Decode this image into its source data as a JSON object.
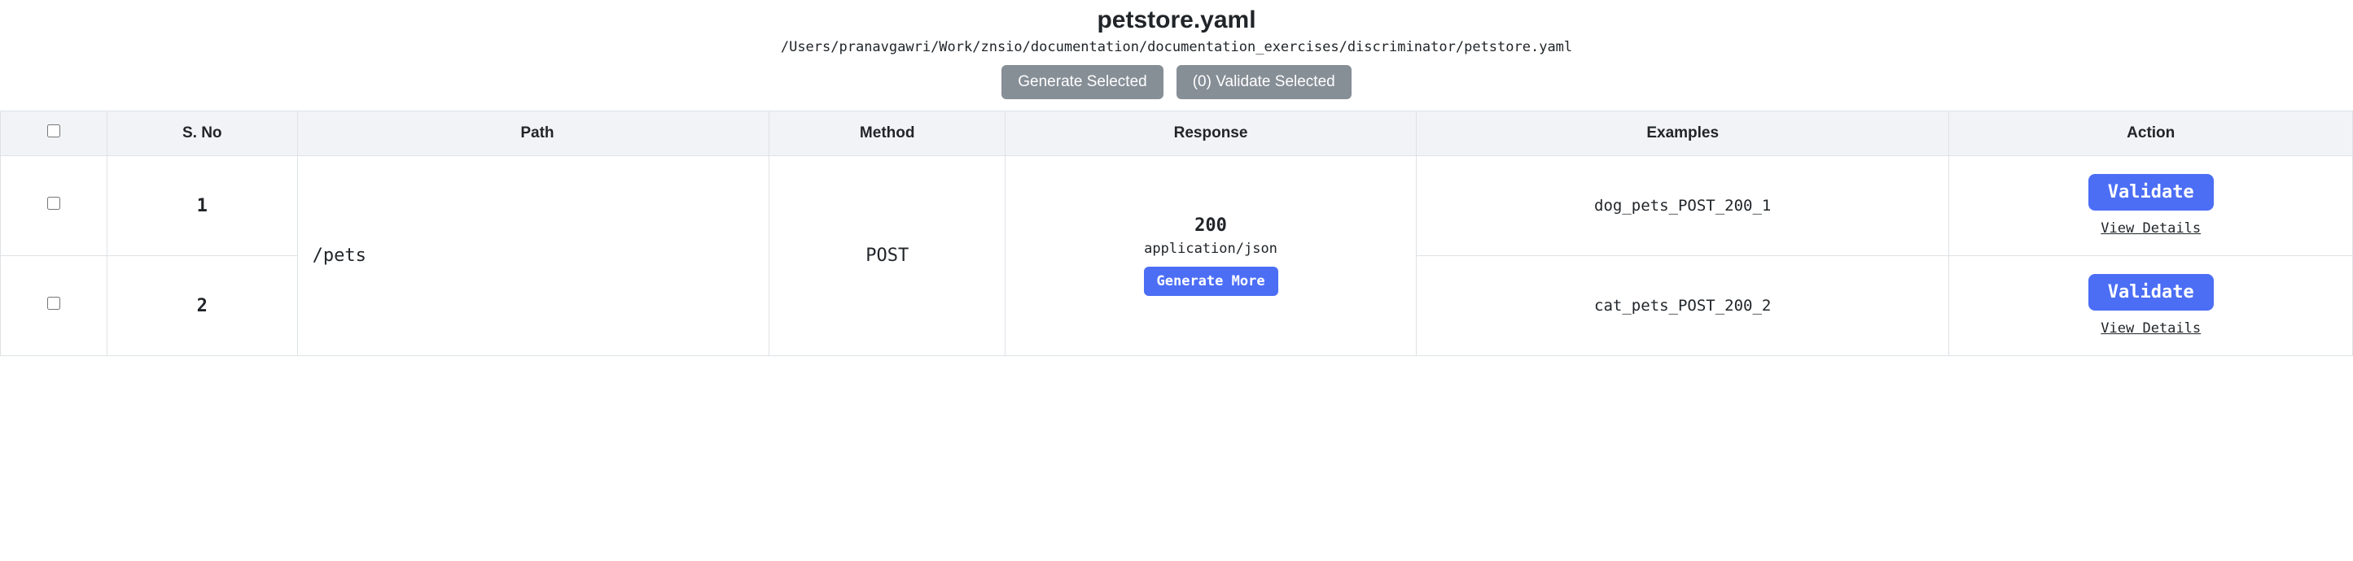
{
  "header": {
    "title": "petstore.yaml",
    "filepath": "/Users/pranavgawri/Work/znsio/documentation/documentation_exercises/discriminator/petstore.yaml"
  },
  "toolbar": {
    "generate_selected_label": "Generate Selected",
    "validate_selected_count": "(0)",
    "validate_selected_label": "Validate Selected"
  },
  "table": {
    "columns": {
      "sno": "S. No",
      "path": "Path",
      "method": "Method",
      "response": "Response",
      "examples": "Examples",
      "action": "Action"
    },
    "group": {
      "path": "/pets",
      "method": "POST",
      "response_code": "200",
      "content_type": "application/json",
      "generate_more_label": "Generate More"
    },
    "rows": [
      {
        "sno": "1",
        "example": "dog_pets_POST_200_1",
        "validate_label": "Validate",
        "view_details_label": "View Details"
      },
      {
        "sno": "2",
        "example": "cat_pets_POST_200_2",
        "validate_label": "Validate",
        "view_details_label": "View Details"
      }
    ]
  }
}
